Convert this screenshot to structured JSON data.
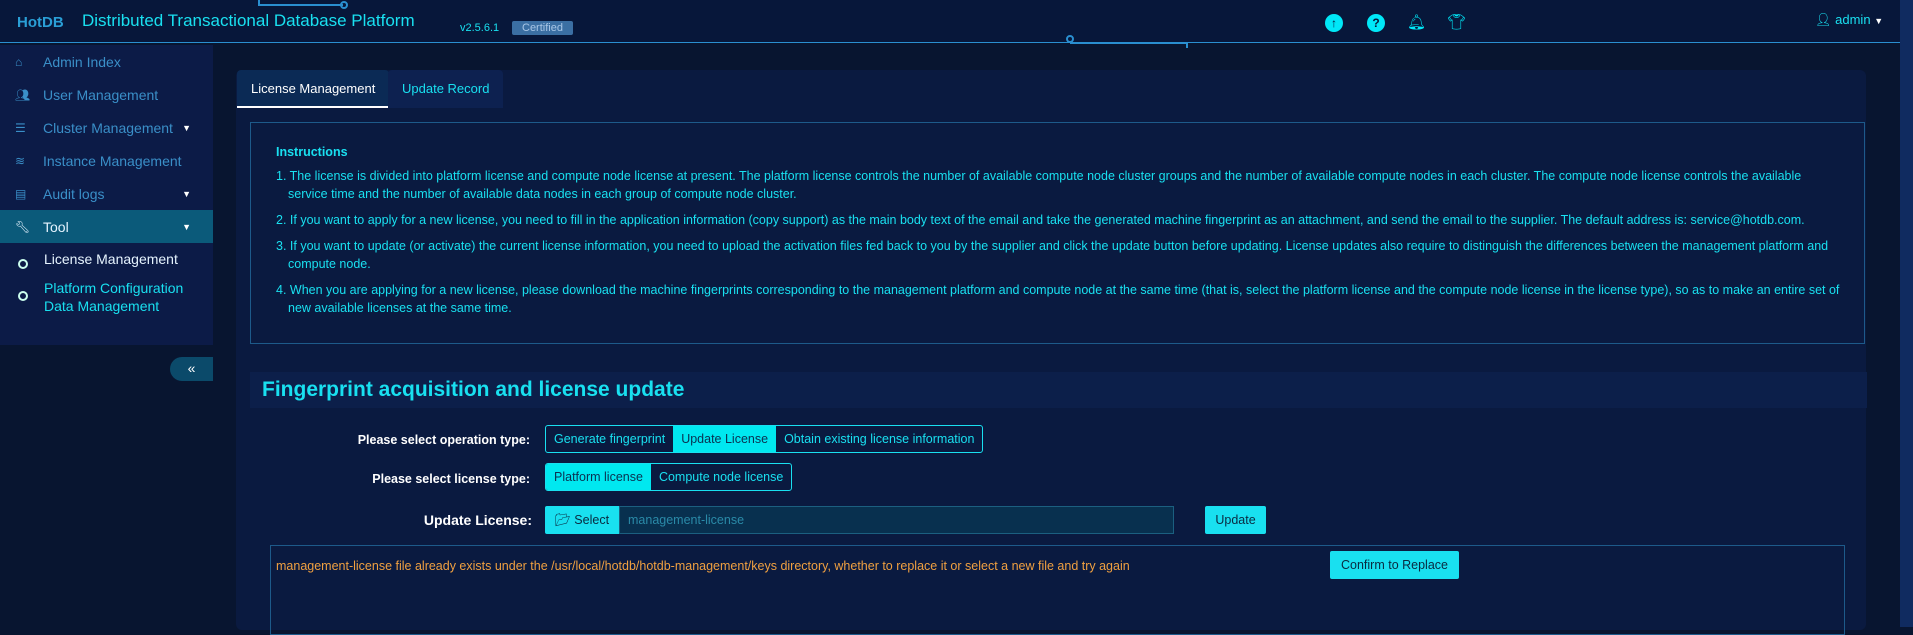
{
  "header": {
    "logo": "HotDB",
    "title": "Distributed Transactional Database Platform",
    "version": "v2.5.6.1",
    "badge": "Certified",
    "user": "admin",
    "icons": [
      "upload-icon",
      "help-icon",
      "bell-icon",
      "theme-shirt-icon",
      "user-icon"
    ]
  },
  "sidebar": {
    "items": [
      {
        "label": "Admin Index",
        "icon": "home-icon"
      },
      {
        "label": "User Management",
        "icon": "users-icon"
      },
      {
        "label": "Cluster Management",
        "icon": "server-icon"
      },
      {
        "label": "Instance Management",
        "icon": "database-icon"
      },
      {
        "label": "Audit logs",
        "icon": "log-icon"
      },
      {
        "label": "Tool",
        "icon": "wrench-icon"
      }
    ],
    "subitems": [
      "License Management",
      "Platform Configuration Data Management"
    ],
    "collapse": "«"
  },
  "tabs": [
    "License Management",
    "Update Record"
  ],
  "instructions": {
    "title": "Instructions",
    "items": [
      "1. The license is divided into platform license and compute node license at present. The platform license controls the number of available compute node cluster groups and the number of available compute nodes in each cluster. The compute node license controls the available service time and the number of available data nodes in each group of compute node cluster.",
      "2. If you want to apply for a new license, you need to fill in the application information (copy support) as the main body text of the email and take the generated machine fingerprint as an attachment, and send the email to the supplier. The default address is: service@hotdb.com.",
      "3. If you want to update (or activate) the current license information, you need to upload the activation files fed back to you by the supplier and click the update button before updating. License updates also require to distinguish the differences between the management platform and compute node.",
      "4. When you are applying for a new license, please download the machine fingerprints corresponding to the management platform and compute node at the same time (that is, select the platform license and the compute node license in the license type), so as to make an entire set of new available licenses at the same time."
    ]
  },
  "section": {
    "title": "Fingerprint acquisition and license update",
    "op_label": "Please select operation type:",
    "op_options": [
      "Generate fingerprint",
      "Update License",
      "Obtain existing license information"
    ],
    "op_selected": "Update License",
    "type_label": "Please select license type:",
    "type_options": [
      "Platform license",
      "Compute node license"
    ],
    "type_selected": "Platform license",
    "update_label": "Update License:",
    "select_btn": "Select",
    "file_value": "management-license",
    "update_btn": "Update",
    "message": "management-license file already exists under the /usr/local/hotdb/hotdb-management/keys directory, whether to replace it or select a new file and try again",
    "confirm_btn": "Confirm to Replace"
  }
}
